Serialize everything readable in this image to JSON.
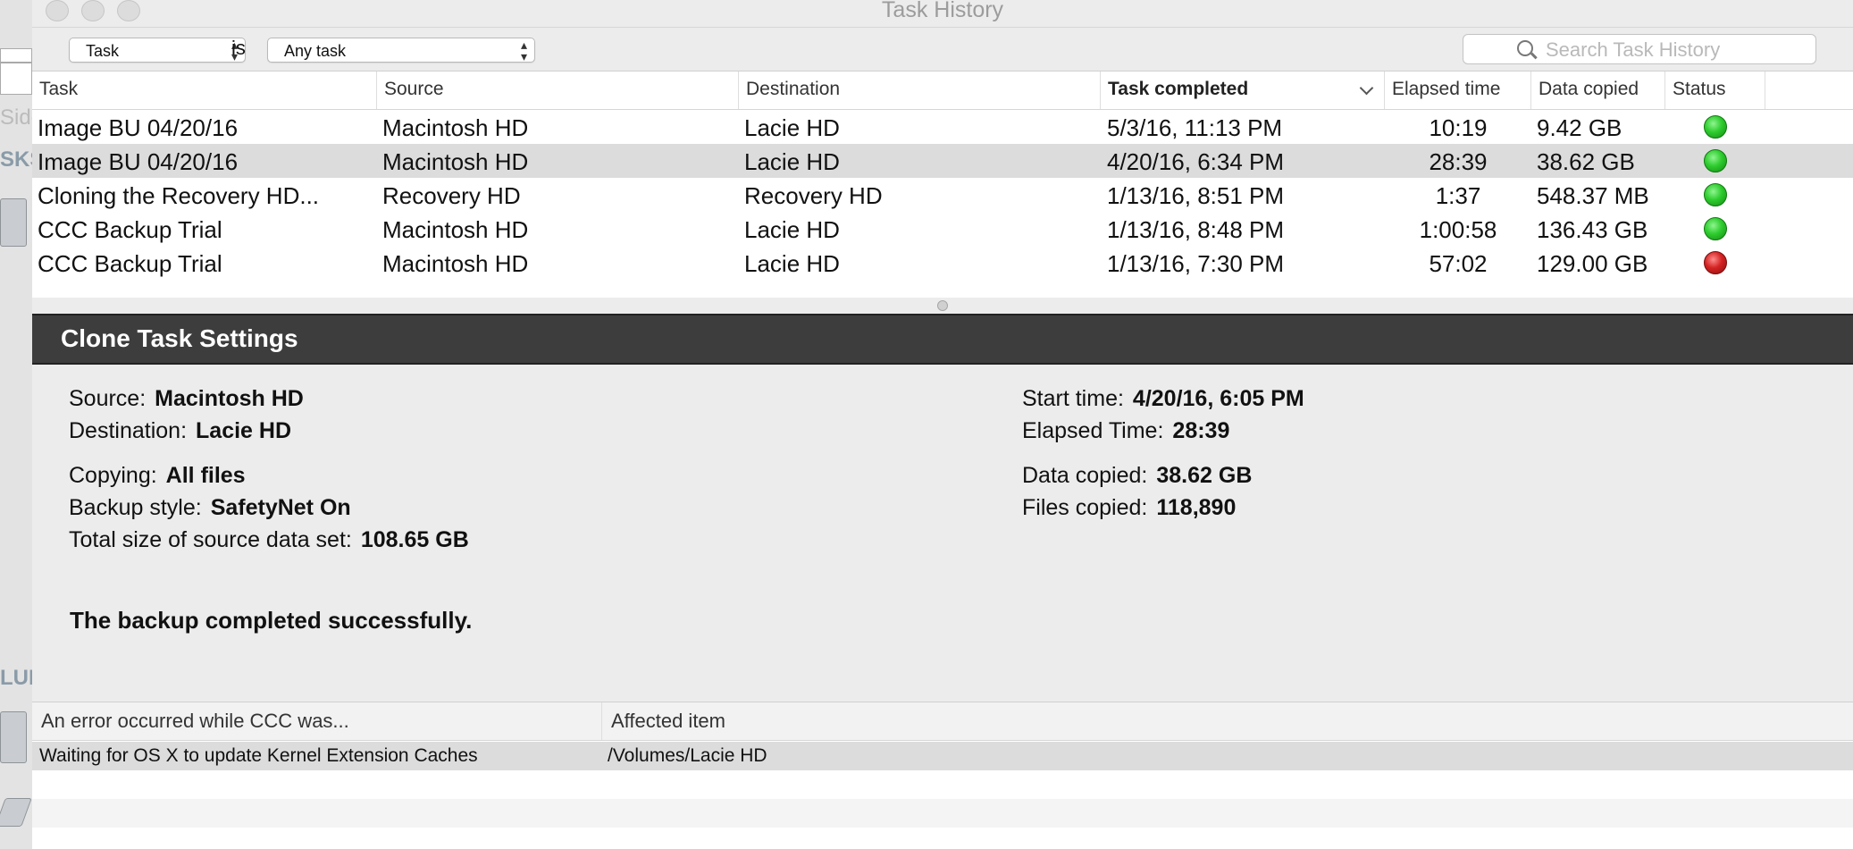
{
  "window": {
    "title": "Task History"
  },
  "background_window": {
    "sidebar_label": "Side",
    "section_labels": [
      "SKS",
      "LUM"
    ]
  },
  "filter": {
    "field": "Task",
    "operator": "is",
    "value": "Any task",
    "search_placeholder": "Search Task History"
  },
  "history_table": {
    "columns": [
      "Task",
      "Source",
      "Destination",
      "Task completed",
      "Elapsed time",
      "Data copied",
      "Status"
    ],
    "sorted_column": "Task completed",
    "rows": [
      {
        "task": "Image BU 04/20/16",
        "source": "Macintosh HD",
        "destination": "Lacie HD",
        "completed": "5/3/16, 11:13 PM",
        "elapsed": "10:19",
        "data": "9.42 GB",
        "status": "green"
      },
      {
        "task": "Image BU 04/20/16",
        "source": "Macintosh HD",
        "destination": "Lacie HD",
        "completed": "4/20/16, 6:34 PM",
        "elapsed": "28:39",
        "data": "38.62 GB",
        "status": "green",
        "selected": true
      },
      {
        "task": "Cloning the Recovery HD...",
        "source": "Recovery HD",
        "destination": "Recovery HD",
        "completed": "1/13/16, 8:51 PM",
        "elapsed": "1:37",
        "data": "548.37 MB",
        "status": "green"
      },
      {
        "task": "CCC Backup Trial",
        "source": "Macintosh HD",
        "destination": "Lacie HD",
        "completed": "1/13/16, 8:48 PM",
        "elapsed": "1:00:58",
        "data": "136.43 GB",
        "status": "green"
      },
      {
        "task": "CCC Backup Trial",
        "source": "Macintosh HD",
        "destination": "Lacie HD",
        "completed": "1/13/16, 7:30 PM",
        "elapsed": "57:02",
        "data": "129.00 GB",
        "status": "red"
      }
    ]
  },
  "settings": {
    "header": "Clone Task Settings",
    "source": {
      "label": "Source:",
      "value": "Macintosh HD"
    },
    "destination": {
      "label": "Destination:",
      "value": "Lacie HD"
    },
    "copying": {
      "label": "Copying:",
      "value": "All files"
    },
    "backup_style": {
      "label": "Backup style:",
      "value": "SafetyNet On"
    },
    "total_size": {
      "label": "Total size of source data set:",
      "value": "108.65 GB"
    },
    "start_time": {
      "label": "Start time:",
      "value": "4/20/16, 6:05 PM"
    },
    "elapsed_time": {
      "label": "Elapsed Time:",
      "value": "28:39"
    },
    "data_copied": {
      "label": "Data copied:",
      "value": "38.62 GB"
    },
    "files_copied": {
      "label": "Files copied:",
      "value": "118,890"
    },
    "result": "The backup completed successfully."
  },
  "error_table": {
    "columns": [
      "An error occurred while CCC was...",
      "Affected item"
    ],
    "rows": [
      {
        "error": "Waiting for OS X to update Kernel Extension Caches",
        "item": "/Volumes/Lacie HD"
      }
    ]
  },
  "colors": {
    "status_green": "#2ecc2e",
    "status_red": "#d42222",
    "header_bg": "#3d3d3d",
    "selected_row": "#dcdcdc"
  }
}
